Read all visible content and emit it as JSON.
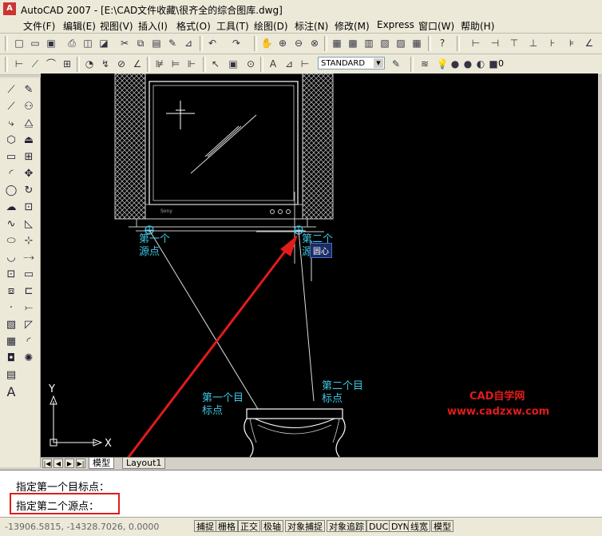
{
  "window": {
    "app_icon": "A",
    "title": "AutoCAD 2007 - [E:\\CAD文件收藏\\很齐全的综合图库.dwg]"
  },
  "menu": [
    "文件(F)",
    "编辑(E)",
    "视图(V)",
    "插入(I)",
    "格式(O)",
    "工具(T)",
    "绘图(D)",
    "标注(N)",
    "修改(M)",
    "Express",
    "窗口(W)",
    "帮助(H)"
  ],
  "toolbar": {
    "text_style": "STANDARD",
    "layer": "0"
  },
  "left_palette": {
    "text_tool": "A"
  },
  "drawing": {
    "source_point_1": [
      "第一个",
      "源点"
    ],
    "source_point_2": [
      "第二个",
      "源点"
    ],
    "target_point_1": [
      "第一个目",
      "标点"
    ],
    "target_point_2": [
      "第二个目",
      "标点"
    ],
    "tooltip": "圆心",
    "tv_brand": "Sony",
    "axis_x": "X",
    "axis_y": "Y",
    "watermark_title": "CAD自学网",
    "watermark_url": "www.cadzxw.com",
    "colors": {
      "label": "#3ec7e6",
      "arrow": "#e21b1b",
      "canvas": "#000000"
    }
  },
  "tabs": [
    "模型",
    "Layout1"
  ],
  "command": {
    "line1": "指定第一个目标点：",
    "line2": "指定第二个源点："
  },
  "status": {
    "coords": "-13906.5815, -14328.7026, 0.0000",
    "toggles": [
      "捕捉",
      "栅格",
      "正交",
      "极轴",
      "对象捕捉",
      "对象追踪",
      "DUCS",
      "DYN",
      "线宽",
      "模型"
    ]
  },
  "icons": [
    "new-icon",
    "open-icon",
    "save-icon",
    "plot-icon",
    "cut-icon",
    "copy-icon",
    "paste-icon",
    "undo-icon",
    "redo-icon",
    "pan-icon",
    "zoom-icon",
    "properties-icon",
    "line-icon",
    "polyline-icon",
    "circle-icon",
    "arc-icon",
    "rectangle-icon",
    "hatch-icon",
    "erase-icon",
    "copy-object-icon",
    "mirror-icon",
    "offset-icon",
    "array-icon",
    "move-icon",
    "rotate-icon",
    "scale-icon",
    "stretch-icon",
    "trim-icon",
    "extend-icon",
    "text-icon"
  ]
}
